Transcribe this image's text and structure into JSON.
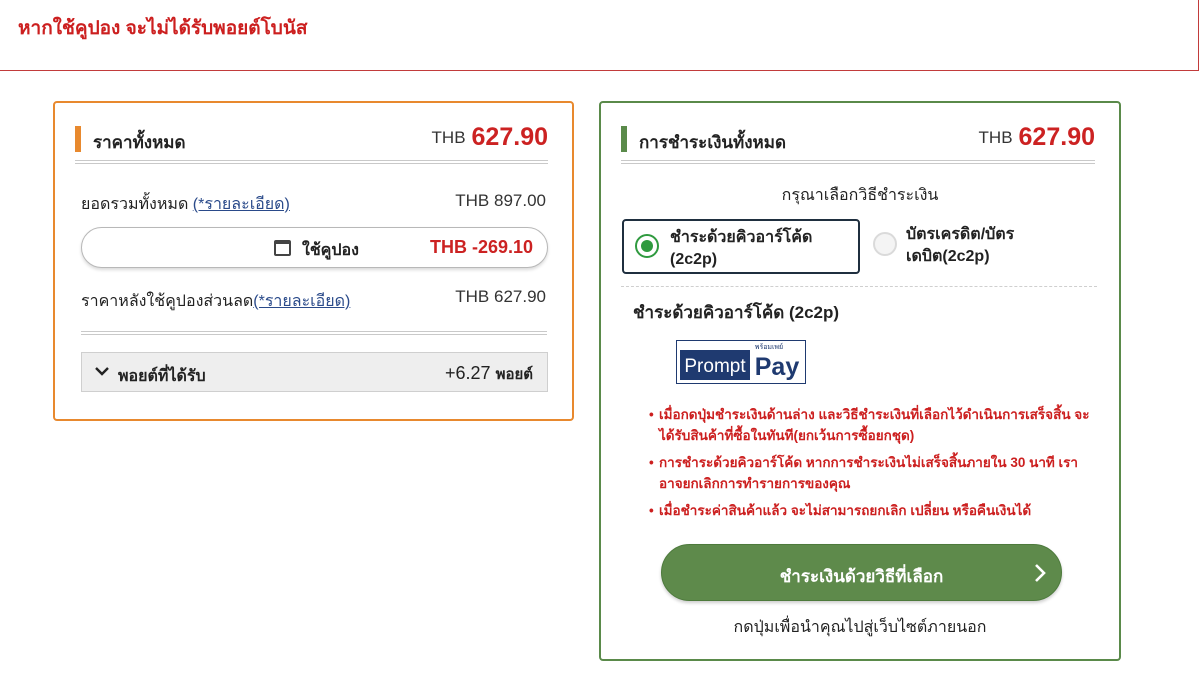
{
  "banner": {
    "message": "หากใช้คูปอง จะไม่ได้รับพอยต์โบนัส",
    "border_color": "#c23b3b"
  },
  "price_summary": {
    "title": "ราคาทั้งหมด",
    "currency": "THB",
    "total": "627.90",
    "accent_color": "#e8892e",
    "subtotal_label": "ยอดรวมทั้งหมด ",
    "subtotal_link": "(*รายละเอียด)",
    "subtotal_value": "THB 897.00",
    "coupon": {
      "icon": "calendar-icon",
      "label": "ใช้คูปอง",
      "value": "THB -269.10"
    },
    "after_coupon_label": "ราคาหลังใช้คูปองส่วนลด",
    "after_coupon_link": "(*รายละเอียด)",
    "after_coupon_value": "THB 627.90",
    "points": {
      "icon": "chevron-down-icon",
      "label": "พอยต์ที่ได้รับ",
      "value": "+6.27",
      "unit": "พอยต์"
    }
  },
  "payment": {
    "title": "การชำระเงินทั้งหมด",
    "currency": "THB",
    "total": "627.90",
    "accent_color": "#5a8a4a",
    "choose_label": "กรุณาเลือกวิธีชำระเงิน",
    "methods": [
      {
        "label_line1": "ชำระด้วยคิวอาร์โค้ด",
        "label_line2": "(2c2p)",
        "selected": true
      },
      {
        "label_line1": "บัตรเครดิต/บัตร",
        "label_line2": "เดบิต(2c2p)",
        "selected": false
      }
    ],
    "method_heading": "ชำระด้วยคิวอาร์โค้ด (2c2p)",
    "logo": {
      "small_text": "พร้อมเพย์",
      "word1": "Prompt",
      "word2": "Pay"
    },
    "notes": [
      "เมื่อกดปุ่มชำระเงินด้านล่าง และวิธีชำระเงินที่เลือกไว้ดำเนินการเสร็จสิ้น จะได้รับสินค้าที่ซื้อในทันที(ยกเว้นการซื้อยกชุด)",
      "การชำระด้วยคิวอาร์โค้ด หากการชำระเงินไม่เสร็จสิ้นภายใน 30 นาที เราอาจยกเลิกการทำรายการของคุณ",
      "เมื่อชำระค่าสินค้าแล้ว จะไม่สามารถยกเลิก เปลี่ยน หรือคืนเงินได้"
    ],
    "pay_button": "ชำระเงินด้วยวิธีที่เลือก",
    "pay_button_color": "#5e8a4b",
    "external_note": "กดปุ่มเพื่อนำคุณไปสู่เว็บไซต์ภายนอก"
  }
}
